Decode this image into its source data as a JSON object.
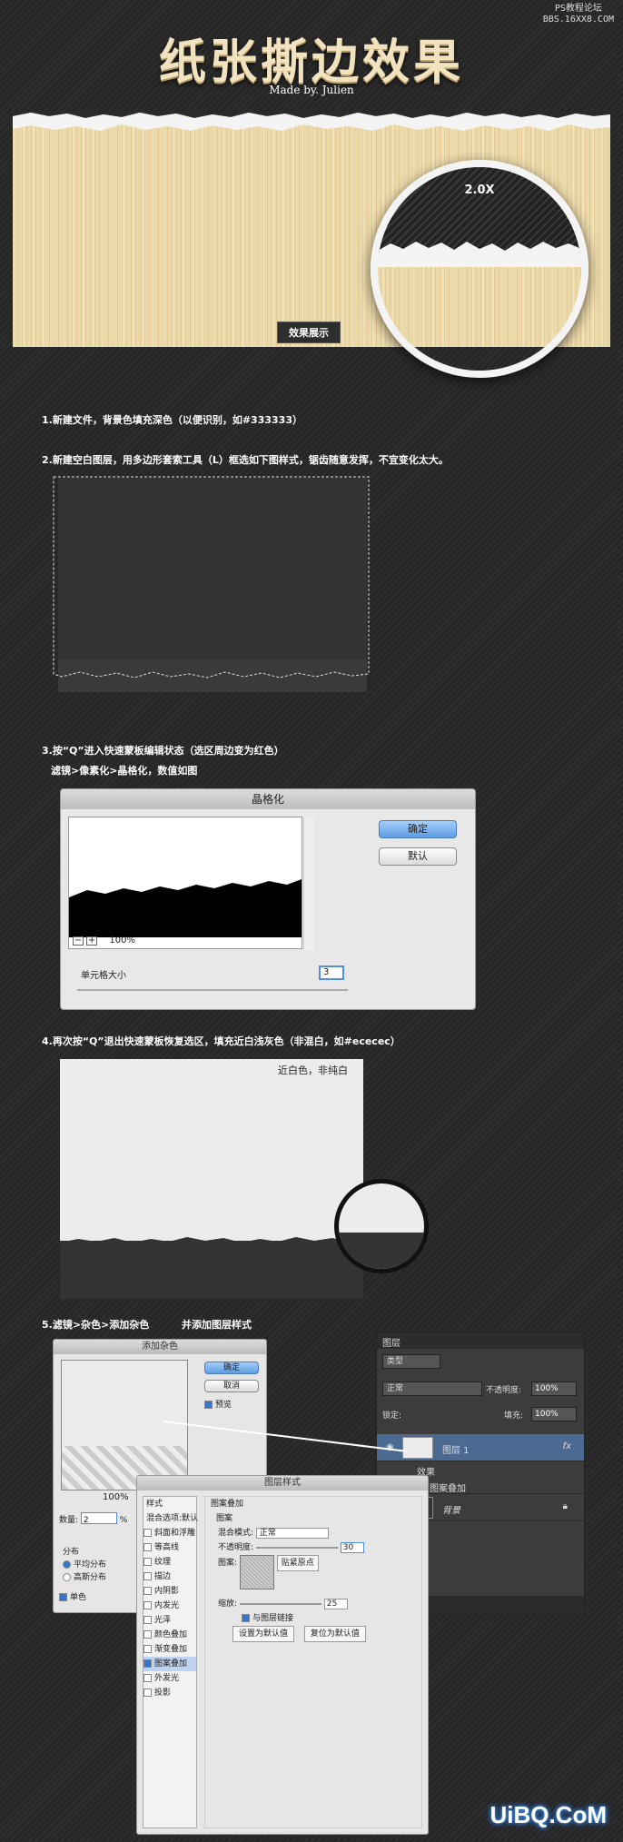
{
  "watermark_top": {
    "line1": "PS教程论坛",
    "line2": "BBS.16XX8.COM"
  },
  "hero": {
    "title": "纸张撕边效果",
    "subtitle": "Made by. Julien",
    "zoom_label": "2.0X",
    "badge": "效果展示"
  },
  "steps": {
    "s1": "1.新建文件，背景色填充深色（以便识别，如#333333）",
    "s2": "2.新建空白图层，用多边形套索工具（L）框选如下图样式，锯齿随意发挥，不宜变化太大。",
    "s3a": "3.按“Q”进入快速蒙板编辑状态（选区周边变为红色）",
    "s3b": "滤镜>像素化>晶格化，数值如图",
    "s4": "4.再次按“Q”退出快速蒙板恢复选区，填充近白浅灰色（非混白，如#ececec）",
    "s5a": "5.滤镜>杂色>添加杂色",
    "s5b": "并添加图层样式"
  },
  "crystallize": {
    "title": "晶格化",
    "ok": "确定",
    "default": "默认",
    "zoom": "100%",
    "cell_label": "单元格大小",
    "cell_value": "3"
  },
  "step4_note": "近白色，非纯白",
  "noise": {
    "title": "添加杂色",
    "ok": "确定",
    "cancel": "取消",
    "preview": "预览",
    "zoom": "100%",
    "amount_label": "数量:",
    "amount_value": "2",
    "unit": "%",
    "dist_label": "分布",
    "uniform": "平均分布",
    "gaussian": "高斯分布",
    "mono": "单色"
  },
  "layers": {
    "tab": "图层",
    "filter": "类型",
    "blend": "正常",
    "opacity_label": "不透明度:",
    "opacity": "100%",
    "lock_label": "锁定:",
    "fill_label": "填充:",
    "fill": "100%",
    "layer1": "图层 1",
    "effects": "效果",
    "pattern_overlay": "图案叠加",
    "background": "背景"
  },
  "layer_style": {
    "title": "图层样式",
    "styles": "样式",
    "blend_options": "混合选项:默认",
    "items": [
      "斜面和浮雕",
      "等高线",
      "纹理",
      "描边",
      "内阴影",
      "内发光",
      "光泽",
      "颜色叠加",
      "渐变叠加",
      "图案叠加",
      "外发光",
      "投影"
    ],
    "section": "图案叠加",
    "pattern": "图案",
    "mode_label": "混合模式:",
    "mode": "正常",
    "opacity_label": "不透明度:",
    "opacity": "30",
    "pattern_label": "图案:",
    "snap": "贴紧原点",
    "scale_label": "缩放:",
    "scale": "25",
    "link": "与图层链接",
    "set_default": "设置为默认值",
    "reset_default": "复位为默认值"
  },
  "watermark_bottom": "UiBQ.CoM"
}
